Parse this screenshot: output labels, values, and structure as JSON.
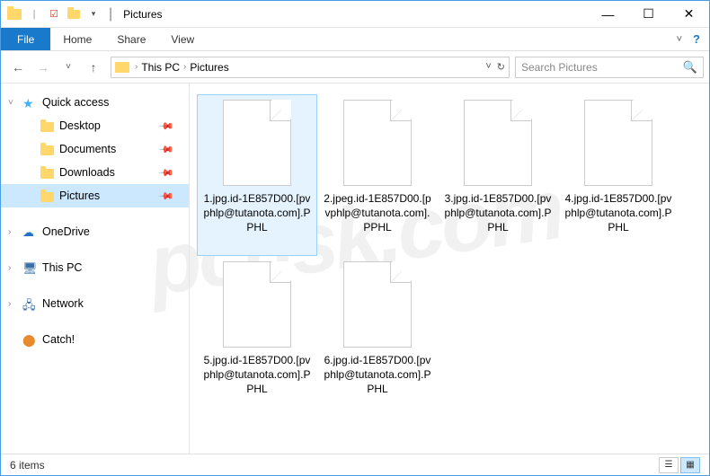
{
  "window": {
    "title": "Pictures"
  },
  "ribbon": {
    "file": "File",
    "tabs": [
      "Home",
      "Share",
      "View"
    ]
  },
  "breadcrumb": {
    "items": [
      "This PC",
      "Pictures"
    ]
  },
  "search": {
    "placeholder": "Search Pictures"
  },
  "sidebar": {
    "quick_access": "Quick access",
    "quick_items": [
      {
        "label": "Desktop",
        "pinned": true
      },
      {
        "label": "Documents",
        "pinned": true
      },
      {
        "label": "Downloads",
        "pinned": true
      },
      {
        "label": "Pictures",
        "pinned": true,
        "selected": true
      }
    ],
    "onedrive": "OneDrive",
    "this_pc": "This PC",
    "network": "Network",
    "catch": "Catch!"
  },
  "files": [
    {
      "name": "1.jpg.id-1E857D00.[pvphlp@tutanota.com].PPHL",
      "selected": true
    },
    {
      "name": "2.jpeg.id-1E857D00.[pvphlp@tutanota.com].PPHL"
    },
    {
      "name": "3.jpg.id-1E857D00.[pvphlp@tutanota.com].PPHL"
    },
    {
      "name": "4.jpg.id-1E857D00.[pvphlp@tutanota.com].PPHL"
    },
    {
      "name": "5.jpg.id-1E857D00.[pvphlp@tutanota.com].PPHL"
    },
    {
      "name": "6.jpg.id-1E857D00.[pvphlp@tutanota.com].PPHL"
    }
  ],
  "status": {
    "count": "6 items"
  }
}
